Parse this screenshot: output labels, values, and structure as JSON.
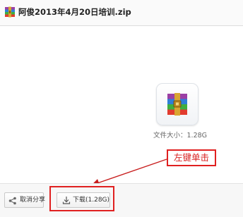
{
  "header": {
    "title": "阿俊2013年4月20日培训.zip",
    "icon": "winrar-archive-icon"
  },
  "file": {
    "thumbnail_icon": "winrar-archive-icon",
    "size_text": "文件大小：1.28G"
  },
  "annotation": {
    "text": "左键单击",
    "color": "#e02020"
  },
  "actions": {
    "cancel_share_label": "取消分享",
    "cancel_share_icon": "share-icon",
    "download_label": "下载(1.28G)",
    "download_icon": "download-icon"
  }
}
